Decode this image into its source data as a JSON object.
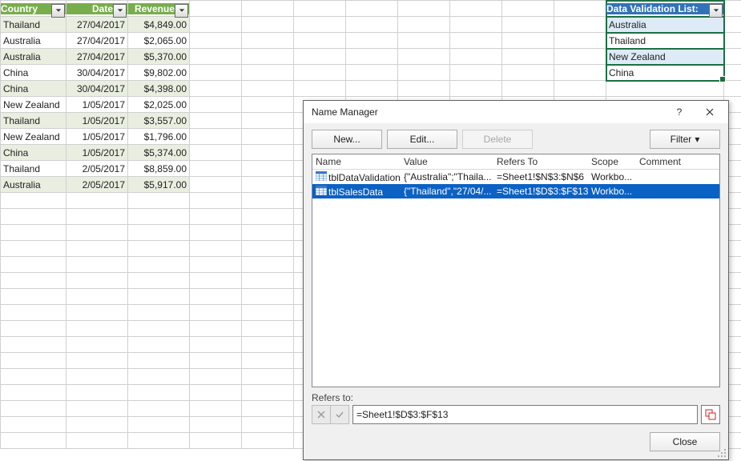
{
  "sales_table": {
    "headers": {
      "country": "Country",
      "date": "Date",
      "revenue": "Revenue"
    },
    "rows": [
      {
        "country": "Thailand",
        "date": "27/04/2017",
        "revenue": "$4,849.00"
      },
      {
        "country": "Australia",
        "date": "27/04/2017",
        "revenue": "$2,065.00"
      },
      {
        "country": "Australia",
        "date": "27/04/2017",
        "revenue": "$5,370.00"
      },
      {
        "country": "China",
        "date": "30/04/2017",
        "revenue": "$9,802.00"
      },
      {
        "country": "China",
        "date": "30/04/2017",
        "revenue": "$4,398.00"
      },
      {
        "country": "New Zealand",
        "date": "1/05/2017",
        "revenue": "$2,025.00"
      },
      {
        "country": "Thailand",
        "date": "1/05/2017",
        "revenue": "$3,557.00"
      },
      {
        "country": "New Zealand",
        "date": "1/05/2017",
        "revenue": "$1,796.00"
      },
      {
        "country": "China",
        "date": "1/05/2017",
        "revenue": "$5,374.00"
      },
      {
        "country": "Thailand",
        "date": "2/05/2017",
        "revenue": "$8,859.00"
      },
      {
        "country": "Australia",
        "date": "2/05/2017",
        "revenue": "$5,917.00"
      }
    ]
  },
  "validation_table": {
    "header": "Data Validation List:",
    "items": [
      "Australia",
      "Thailand",
      "New Zealand",
      "China"
    ]
  },
  "dialog": {
    "title": "Name Manager",
    "help": "?",
    "buttons": {
      "new": "New...",
      "edit": "Edit...",
      "delete": "Delete",
      "filter": "Filter",
      "close": "Close"
    },
    "columns": {
      "name": "Name",
      "value": "Value",
      "refers": "Refers To",
      "scope": "Scope",
      "comment": "Comment"
    },
    "rows": [
      {
        "name": "tblDataValidation",
        "value": "{\"Australia\";\"Thaila...",
        "refers": "=Sheet1!$N$3:$N$6",
        "scope": "Workbo...",
        "selected": false
      },
      {
        "name": "tblSalesData",
        "value": "{\"Thailand\",\"27/04/...",
        "refers": "=Sheet1!$D$3:$F$13",
        "scope": "Workbo...",
        "selected": true
      }
    ],
    "refers_label": "Refers to:",
    "refers_value": "=Sheet1!$D$3:$F$13"
  },
  "chart_data": {
    "type": "table",
    "title": "Sales Data",
    "columns": [
      "Country",
      "Date",
      "Revenue"
    ],
    "rows": [
      [
        "Thailand",
        "2017-04-27",
        4849.0
      ],
      [
        "Australia",
        "2017-04-27",
        2065.0
      ],
      [
        "Australia",
        "2017-04-27",
        5370.0
      ],
      [
        "China",
        "2017-04-30",
        9802.0
      ],
      [
        "China",
        "2017-04-30",
        4398.0
      ],
      [
        "New Zealand",
        "2017-05-01",
        2025.0
      ],
      [
        "Thailand",
        "2017-05-01",
        3557.0
      ],
      [
        "New Zealand",
        "2017-05-01",
        1796.0
      ],
      [
        "China",
        "2017-05-01",
        5374.0
      ],
      [
        "Thailand",
        "2017-05-02",
        8859.0
      ],
      [
        "Australia",
        "2017-05-02",
        5917.0
      ]
    ]
  }
}
